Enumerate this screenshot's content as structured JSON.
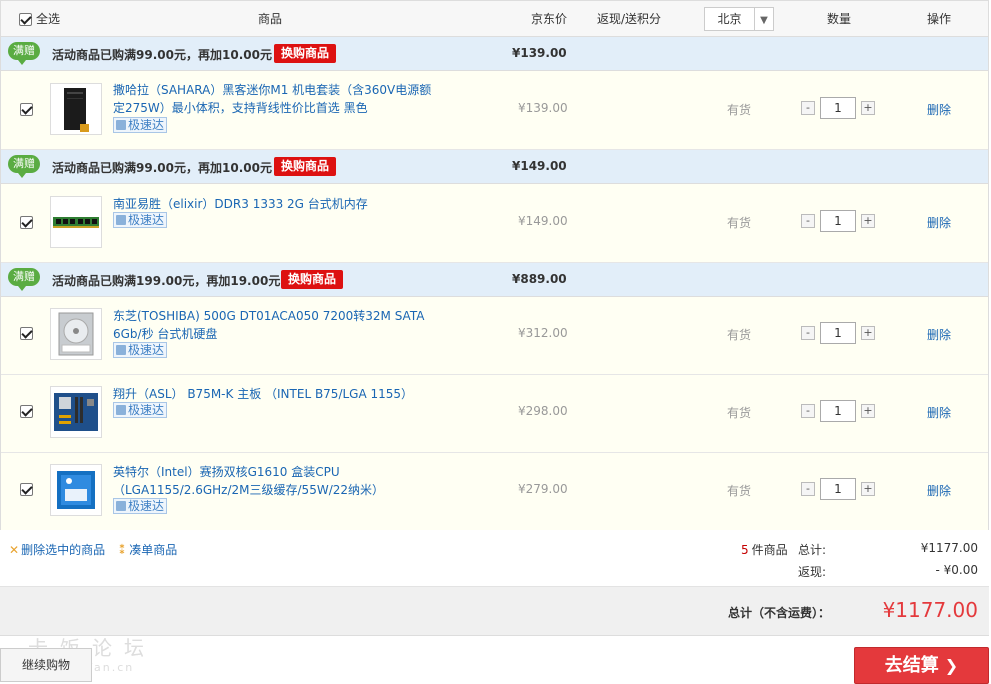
{
  "header": {
    "select_all": "全选",
    "product": "商品",
    "price": "京东价",
    "rebate": "返现/送积分",
    "region": "北京",
    "quantity": "数量",
    "operation": "操作"
  },
  "groups": [
    {
      "badge": "满赠",
      "promo_prefix": "活动商品已购满",
      "promo_amount": "99.00",
      "promo_mid": "元，再加",
      "promo_add": "10.00",
      "promo_suffix": "元",
      "swap_label": "换购商品",
      "subtotal": "¥139.00",
      "items": [
        {
          "title": "撒哈拉（SAHARA）黑客迷你M1 机电套装（含360V电源额定275W）最小体积，支持背线性价比首选 黑色",
          "fast": "极速达",
          "price": "¥139.00",
          "stock": "有货",
          "qty": "1",
          "delete": "删除"
        }
      ]
    },
    {
      "badge": "满赠",
      "promo_prefix": "活动商品已购满",
      "promo_amount": "99.00",
      "promo_mid": "元，再加",
      "promo_add": "10.00",
      "promo_suffix": "元",
      "swap_label": "换购商品",
      "subtotal": "¥149.00",
      "items": [
        {
          "title": "南亚易胜（elixir）DDR3 1333 2G 台式机内存",
          "fast": "极速达",
          "price": "¥149.00",
          "stock": "有货",
          "qty": "1",
          "delete": "删除"
        }
      ]
    },
    {
      "badge": "满赠",
      "promo_prefix": "活动商品已购满",
      "promo_amount": "199.00",
      "promo_mid": "元，再加",
      "promo_add": "19.00",
      "promo_suffix": "元",
      "swap_label": "换购商品",
      "subtotal": "¥889.00",
      "items": [
        {
          "title": "东芝(TOSHIBA) 500G DT01ACA050 7200转32M SATA 6Gb/秒 台式机硬盘",
          "fast": "极速达",
          "price": "¥312.00",
          "stock": "有货",
          "qty": "1",
          "delete": "删除"
        },
        {
          "title": "翔升（ASL） B75M-K 主板 （INTEL B75/LGA 1155）",
          "fast": "极速达",
          "price": "¥298.00",
          "stock": "有货",
          "qty": "1",
          "delete": "删除"
        },
        {
          "title": "英特尔（Intel）赛扬双核G1610 盒装CPU （LGA1155/2.6GHz/2M三级缓存/55W/22纳米）",
          "fast": "极速达",
          "price": "¥279.00",
          "stock": "有货",
          "qty": "1",
          "delete": "删除"
        }
      ]
    }
  ],
  "summary": {
    "delete_selected": "删除选中的商品",
    "combine": "凑单商品",
    "count_num": "5",
    "count_label": "件商品",
    "total_label": "总计:",
    "total_value": "¥1177.00",
    "rebate_label": "返现:",
    "rebate_value": "- ¥0.00"
  },
  "totalbar": {
    "label": "总计（不含运费）：",
    "value": "¥1177.00"
  },
  "footer": {
    "continue": "继续购物",
    "checkout": "去结算",
    "watermark": "卡饭论坛",
    "watermark_url": "bbs.kafan.cn"
  },
  "colors": {
    "accent_red": "#e4393c",
    "link_blue": "#1a66b3",
    "promo_bg": "#e2eef9",
    "row_bg": "#fffff3",
    "badge_green": "#5aac42"
  }
}
